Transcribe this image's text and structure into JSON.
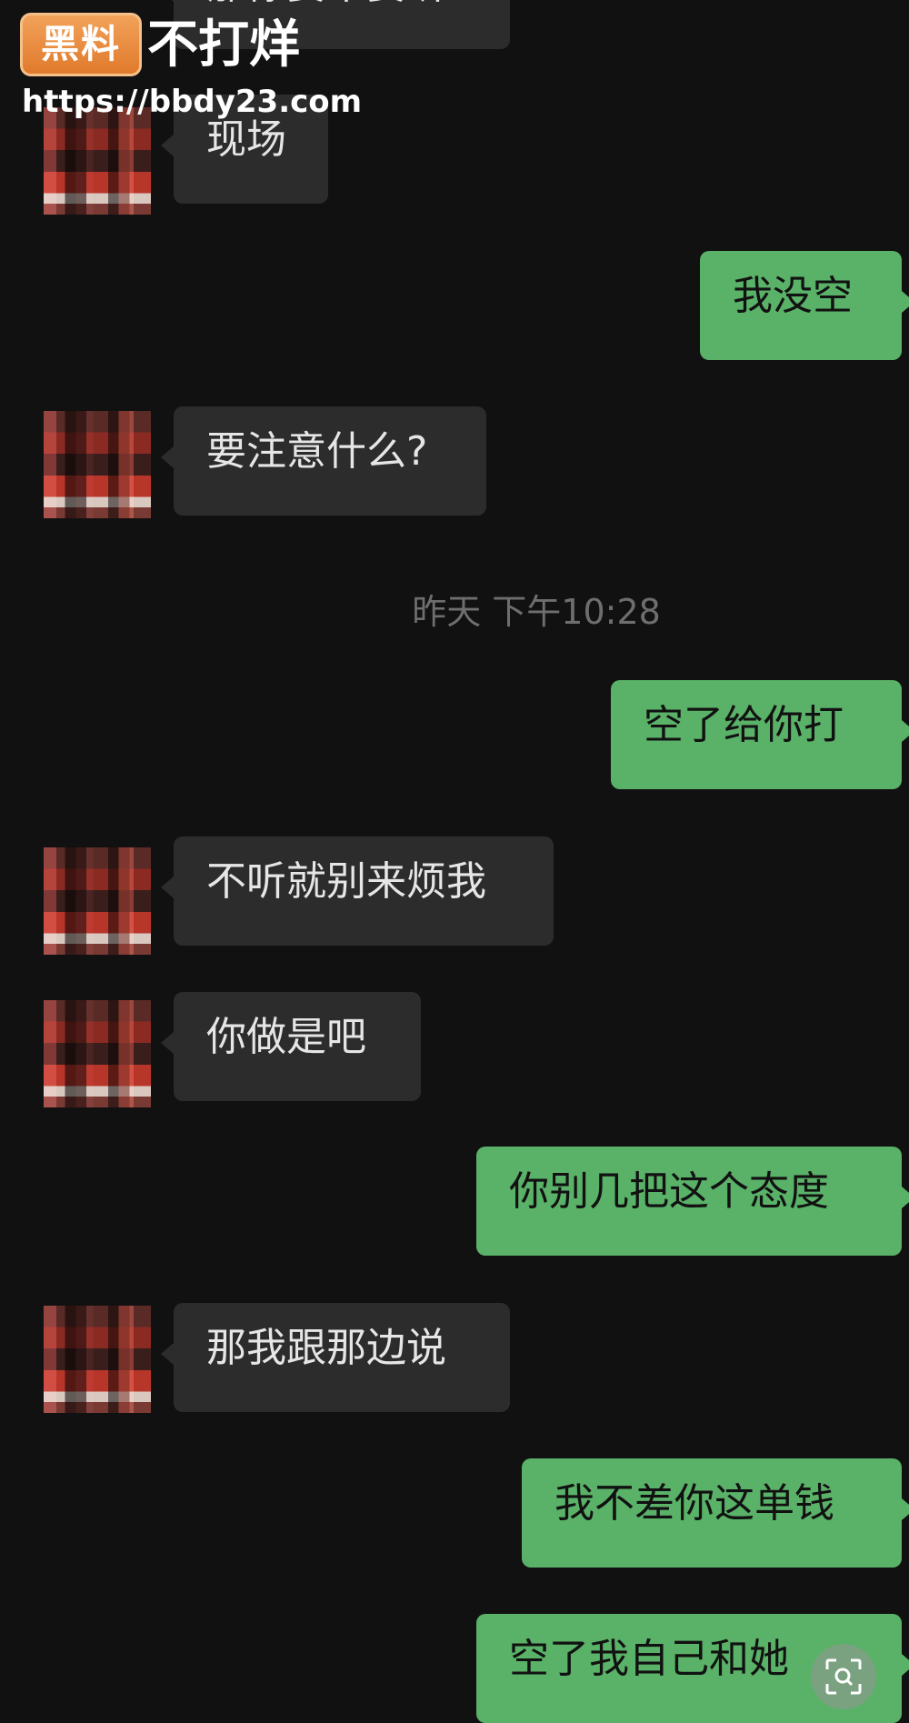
{
  "watermark": {
    "logo_text": "黑料",
    "title": "不打烊",
    "url": "https://bbdy23.com"
  },
  "messages": [
    {
      "side": "in",
      "text": "那你要不要听"
    },
    {
      "side": "in",
      "text": "现场"
    },
    {
      "side": "out",
      "text": "我没空"
    },
    {
      "side": "in",
      "text": "要注意什么?"
    },
    {
      "side": "out",
      "text": "空了给你打"
    },
    {
      "side": "in",
      "text": "不听就别来烦我"
    },
    {
      "side": "in",
      "text": "你做是吧"
    },
    {
      "side": "out",
      "text": "你别几把这个态度"
    },
    {
      "side": "in",
      "text": "那我跟那边说"
    },
    {
      "side": "out",
      "text": "我不差你这单钱"
    },
    {
      "side": "out",
      "text": "空了我自己和她"
    }
  ],
  "timestamp": "昨天 下午10:28",
  "colors": {
    "background": "#111111",
    "incoming_bubble": "#2c2c2c",
    "outgoing_bubble": "#5ab168",
    "timestamp_text": "#6e6e6e"
  },
  "icons": {
    "scan": "scan-search-icon"
  }
}
